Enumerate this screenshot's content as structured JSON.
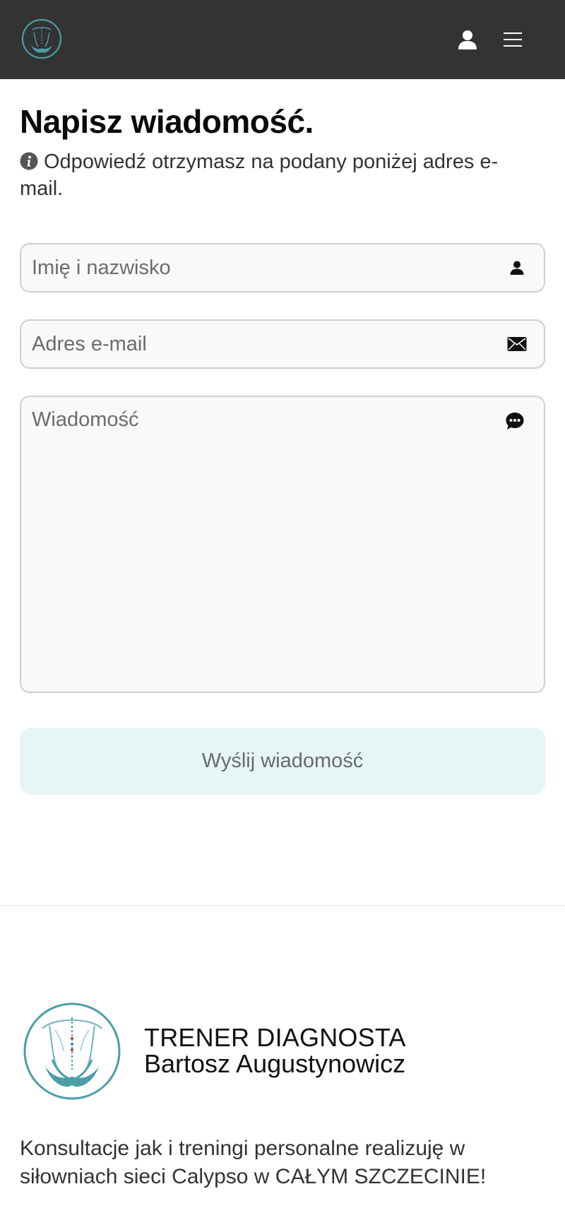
{
  "header": {
    "logo_icon": "spine-hands-logo",
    "user_icon": "user-icon",
    "menu_icon": "hamburger-menu-icon"
  },
  "form": {
    "title": "Napisz wiadomość.",
    "note": "Odpowiedź otrzymasz na podany poniżej adres e-mail.",
    "name_placeholder": "Imię i nazwisko",
    "email_placeholder": "Adres e-mail",
    "message_placeholder": "Wiadomość",
    "submit_label": "Wyślij wiadomość"
  },
  "footer": {
    "brand_line1": "TRENER DIAGNOSTA",
    "brand_line2": "Bartosz Augustynowicz",
    "text": "Konsultacje jak i treningi personalne realizuję w siłowniach sieci Calypso w CAŁYM SZCZECINIE!"
  },
  "colors": {
    "header_bg": "#333333",
    "accent_teal": "#4a9ea6",
    "button_bg": "#e6f6f6"
  }
}
